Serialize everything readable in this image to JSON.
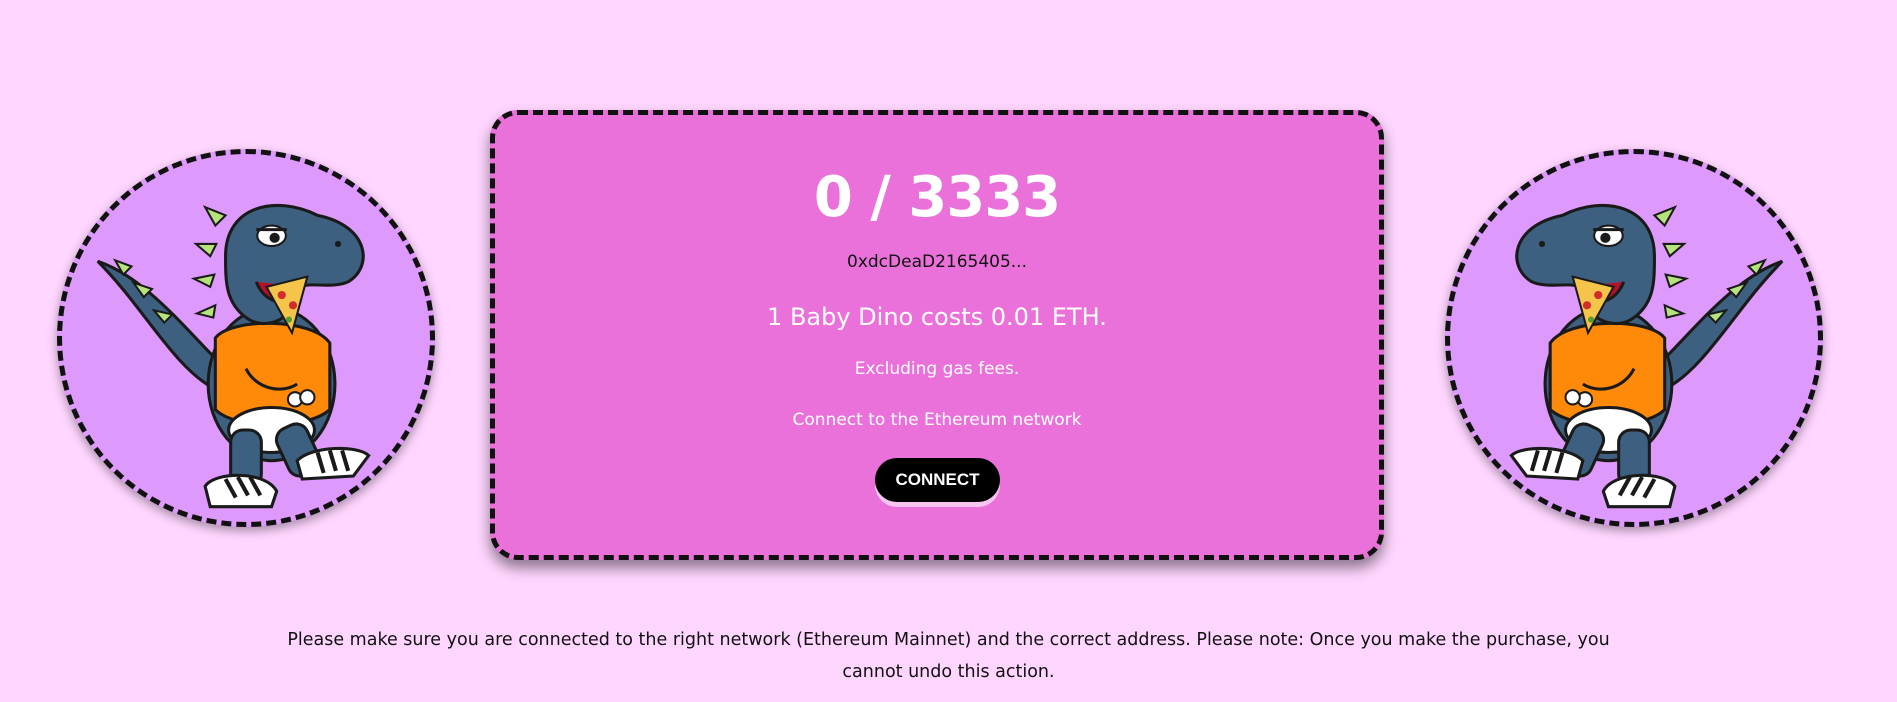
{
  "mint_card": {
    "counter": "0 / 3333",
    "address": "0xdcDeaD2165405...",
    "price_text": "1 Baby Dino costs 0.01 ETH.",
    "gas_note": "Excluding gas fees.",
    "network_prompt": "Connect to the Ethereum network",
    "connect_label": "CONNECT"
  },
  "notice": {
    "text": "Please make sure you are connected to the right network (Ethereum Mainnet) and the correct address. Please note: Once you make the purchase, you cannot undo this action."
  },
  "colors": {
    "background": "#ffd6ff",
    "card": "#ea71da",
    "avatar_bg": "#dd99fb",
    "button": "#000000"
  }
}
